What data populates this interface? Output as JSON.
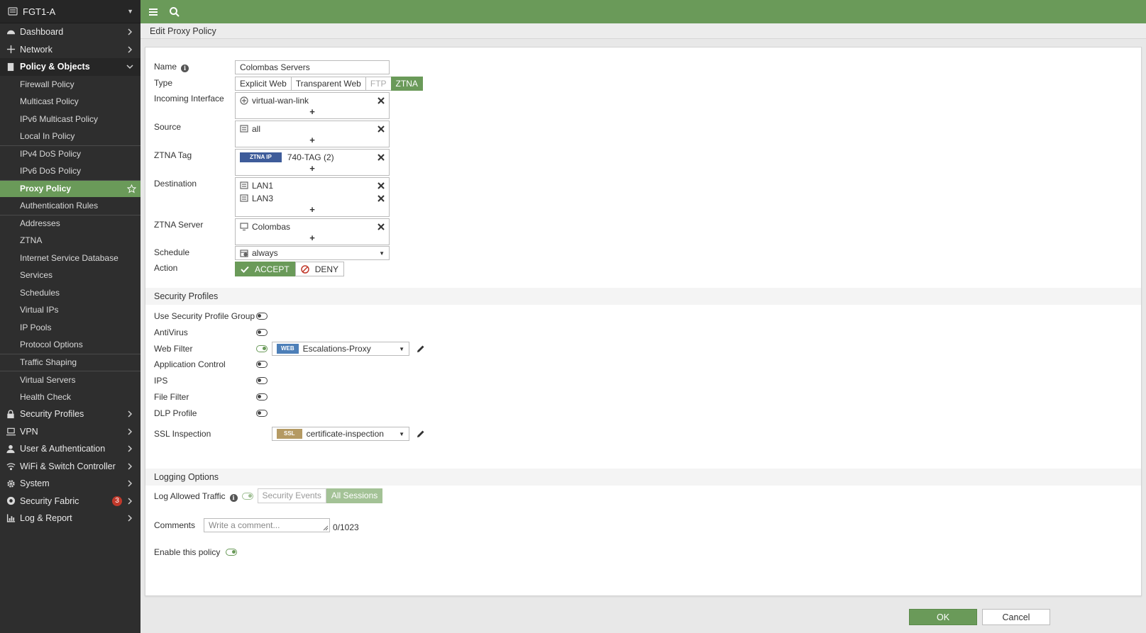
{
  "device": {
    "name": "FGT1-A"
  },
  "sidebar": {
    "top_items": [
      {
        "label": "Dashboard",
        "icon": "dashboard-icon"
      },
      {
        "label": "Network",
        "icon": "network-icon"
      },
      {
        "label": "Policy & Objects",
        "icon": "policy-icon"
      }
    ],
    "sub_items": [
      {
        "label": "Firewall Policy"
      },
      {
        "label": "Multicast Policy"
      },
      {
        "label": "IPv6 Multicast Policy"
      },
      {
        "label": "Local In Policy"
      },
      {
        "label": "IPv4 DoS Policy"
      },
      {
        "label": "IPv6 DoS Policy"
      },
      {
        "label": "Proxy Policy"
      },
      {
        "label": "Authentication Rules"
      },
      {
        "label": "Addresses"
      },
      {
        "label": "ZTNA"
      },
      {
        "label": "Internet Service Database"
      },
      {
        "label": "Services"
      },
      {
        "label": "Schedules"
      },
      {
        "label": "Virtual IPs"
      },
      {
        "label": "IP Pools"
      },
      {
        "label": "Protocol Options"
      },
      {
        "label": "Traffic Shaping"
      },
      {
        "label": "Virtual Servers"
      },
      {
        "label": "Health Check"
      }
    ],
    "bottom_items": [
      {
        "label": "Security Profiles"
      },
      {
        "label": "VPN"
      },
      {
        "label": "User & Authentication"
      },
      {
        "label": "WiFi & Switch Controller"
      },
      {
        "label": "System"
      },
      {
        "label": "Security Fabric",
        "badge": "3"
      },
      {
        "label": "Log & Report"
      }
    ]
  },
  "page": {
    "title": "Edit Proxy Policy"
  },
  "form": {
    "name_label": "Name",
    "name_value": "Colombas Servers",
    "type_label": "Type",
    "type_options": [
      "Explicit Web",
      "Transparent Web",
      "FTP",
      "ZTNA"
    ],
    "type_selected": "ZTNA",
    "incoming_label": "Incoming Interface",
    "incoming_entries": [
      "virtual-wan-link"
    ],
    "source_label": "Source",
    "source_entries": [
      "all"
    ],
    "ztna_tag_label": "ZTNA Tag",
    "ztna_tag_chip": "ZTNA IP",
    "ztna_tag_entries": [
      "740-TAG (2)"
    ],
    "destination_label": "Destination",
    "destination_entries": [
      "LAN1",
      "LAN3"
    ],
    "ztna_server_label": "ZTNA Server",
    "ztna_server_entries": [
      "Colombas"
    ],
    "schedule_label": "Schedule",
    "schedule_value": "always",
    "action_label": "Action",
    "action_accept": "ACCEPT",
    "action_deny": "DENY",
    "plus": "+"
  },
  "security_profiles": {
    "title": "Security Profiles",
    "use_group_label": "Use Security Profile Group",
    "antivirus_label": "AntiVirus",
    "web_filter_label": "Web Filter",
    "web_filter_badge": "WEB",
    "web_filter_value": "Escalations-Proxy",
    "app_control_label": "Application Control",
    "ips_label": "IPS",
    "file_filter_label": "File Filter",
    "dlp_label": "DLP Profile",
    "ssl_label": "SSL Inspection",
    "ssl_badge": "SSL",
    "ssl_value": "certificate-inspection"
  },
  "logging": {
    "title": "Logging Options",
    "log_allowed_label": "Log Allowed Traffic",
    "options": [
      "Security Events",
      "All Sessions"
    ],
    "selected": "All Sessions",
    "comments_label": "Comments",
    "comments_placeholder": "Write a comment...",
    "counter": "0/1023",
    "enable_label": "Enable this policy"
  },
  "footer": {
    "ok": "OK",
    "cancel": "Cancel"
  },
  "colors": {
    "accent": "#6a9a59",
    "sidebar_bg": "#2e2e2e",
    "ztna_tag": "#3e5c9a",
    "web_badge": "#4d7fb8",
    "ssl_badge": "#b59a63",
    "badge_red": "#c0392b"
  }
}
